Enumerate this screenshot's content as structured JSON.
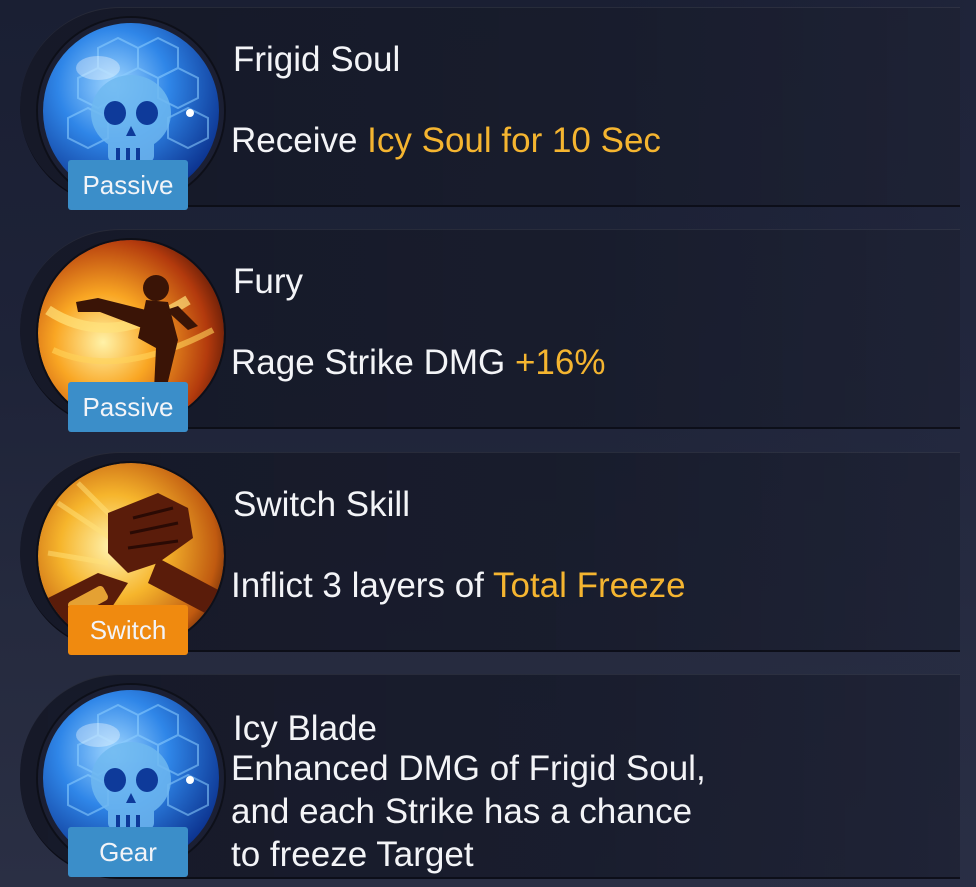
{
  "skills": [
    {
      "icon": "skull-orb-icon",
      "badge": "Passive",
      "badge_color": "#3b8ec9",
      "name": "Frigid Soul",
      "desc_prefix": "Receive ",
      "desc_highlight": "Icy Soul for 10 Sec"
    },
    {
      "icon": "kick-fighter-icon",
      "badge": "Passive",
      "badge_color": "#3b8ec9",
      "name": "Fury",
      "desc_prefix": "Rage Strike DMG ",
      "desc_highlight": "+16%"
    },
    {
      "icon": "arm-grab-icon",
      "badge": "Switch",
      "badge_color": "#f08a0f",
      "name": "Switch Skill",
      "desc_prefix": "Inflict 3 layers of ",
      "desc_highlight": "Total Freeze"
    },
    {
      "icon": "skull-orb-icon",
      "badge": "Gear",
      "badge_color": "#3b8ec9",
      "name": "Icy Blade",
      "desc_lines": [
        "Enhanced DMG of Frigid Soul,",
        "and each Strike has a chance",
        "to freeze Target"
      ]
    }
  ],
  "highlight_color": "#f5b530"
}
